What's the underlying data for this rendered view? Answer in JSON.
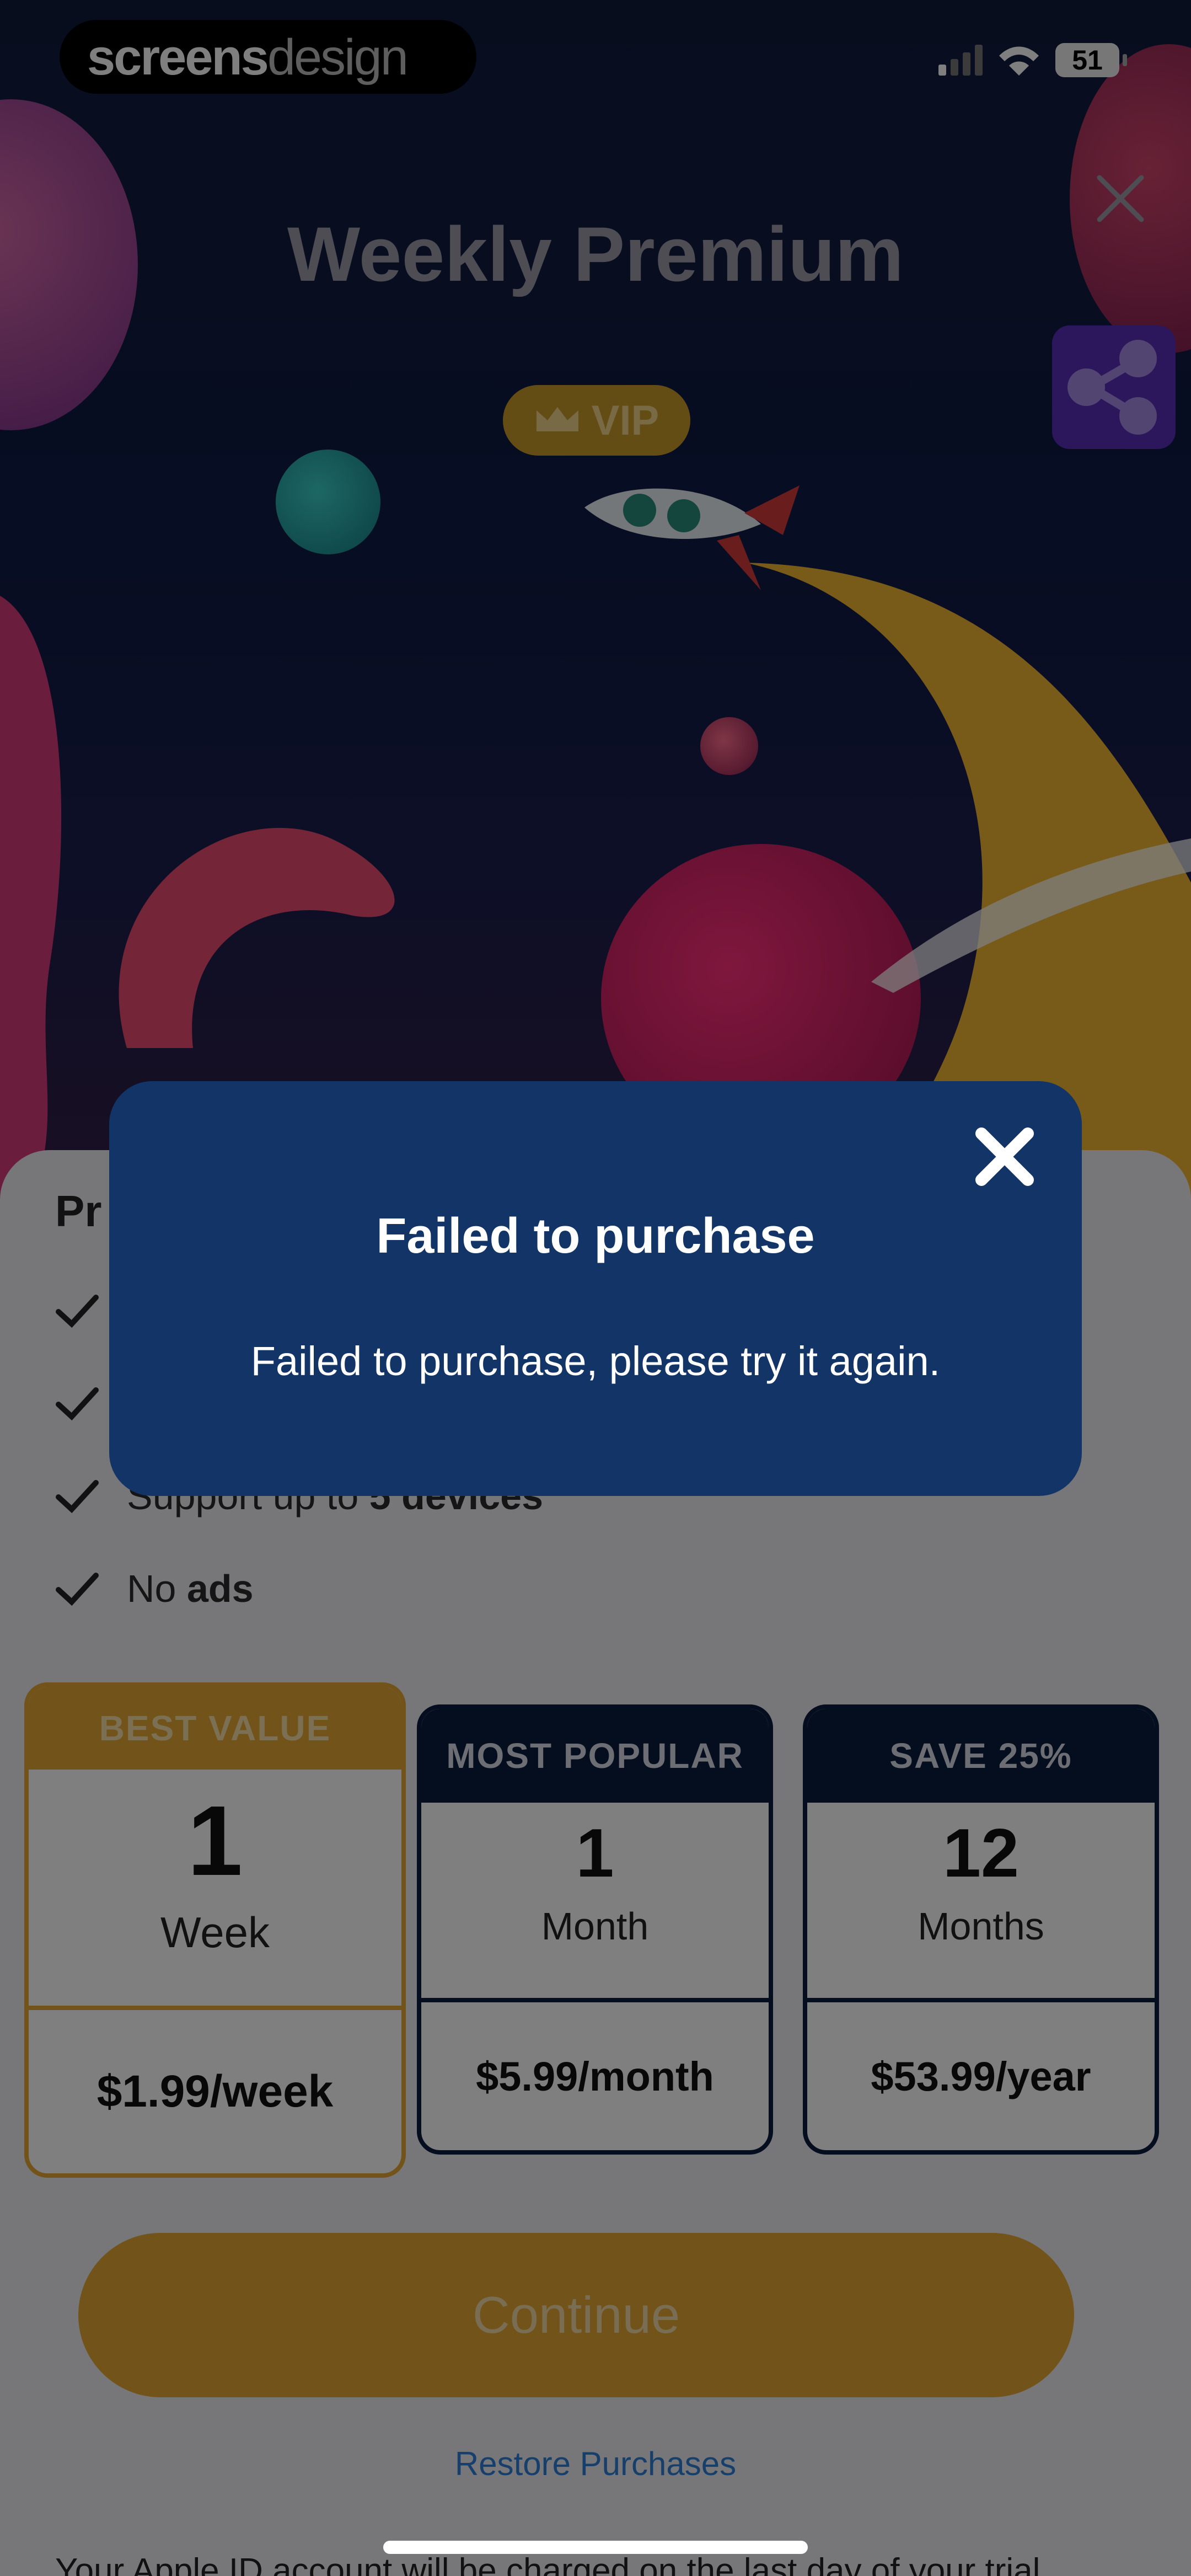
{
  "watermark": {
    "brand_bold": "screens",
    "brand_light": "design"
  },
  "status_bar": {
    "battery": "51"
  },
  "header": {
    "title": "Weekly Premium",
    "vip_label": "VIP"
  },
  "features": {
    "title": "Pr",
    "items": [
      {
        "prefix": "Support up to ",
        "bold": "5 devices"
      },
      {
        "prefix": "No ",
        "bold": "ads"
      }
    ]
  },
  "plans": [
    {
      "badge": "BEST VALUE",
      "number": "1",
      "unit": "Week",
      "price": "$1.99/week"
    },
    {
      "badge": "MOST POPULAR",
      "number": "1",
      "unit": "Month",
      "price": "$5.99/month"
    },
    {
      "badge": "SAVE 25%",
      "number": "12",
      "unit": "Months",
      "price": "$53.99/year"
    }
  ],
  "continue_label": "Continue",
  "restore_label": "Restore Purchases",
  "legal_text": "Your Apple ID account will be charged on the last day of your trial",
  "dialog": {
    "title": "Failed to purchase",
    "message": "Failed to purchase, please try it again."
  },
  "colors": {
    "accent": "#e4a734",
    "dialog_bg": "#123466",
    "plan_dark": "#0b1d3f"
  }
}
